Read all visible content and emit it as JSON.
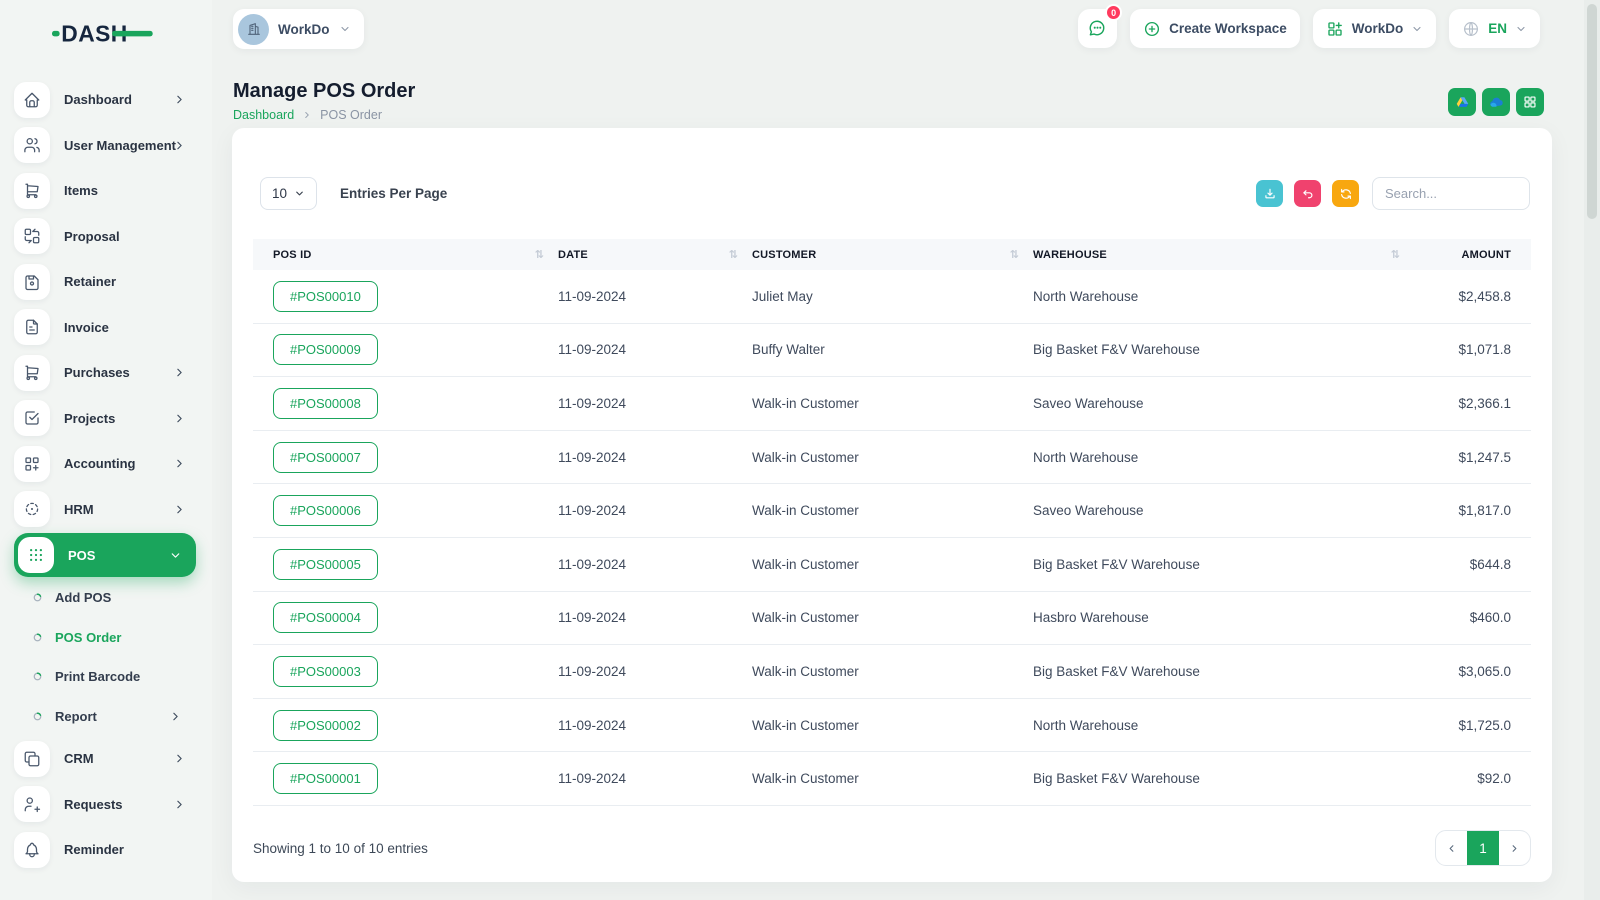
{
  "brand": {
    "logo_text": "DASH"
  },
  "topbar": {
    "workspace_pill_label": "WorkDo",
    "chat_badge": "0",
    "create_workspace_label": "Create Workspace",
    "workspace_menu_label": "WorkDo",
    "language_label": "EN"
  },
  "sidebar": {
    "items_top": [
      {
        "label": "Dashboard"
      },
      {
        "label": "User Management"
      },
      {
        "label": "Items"
      },
      {
        "label": "Proposal"
      },
      {
        "label": "Retainer"
      },
      {
        "label": "Invoice"
      },
      {
        "label": "Purchases"
      },
      {
        "label": "Projects"
      },
      {
        "label": "Accounting"
      },
      {
        "label": "HRM"
      },
      {
        "label": "POS"
      }
    ],
    "pos_submenu": [
      {
        "label": "Add POS"
      },
      {
        "label": "POS Order"
      },
      {
        "label": "Print Barcode"
      },
      {
        "label": "Report"
      }
    ],
    "items_bottom": [
      {
        "label": "CRM"
      },
      {
        "label": "Requests"
      },
      {
        "label": "Reminder"
      }
    ]
  },
  "page": {
    "title": "Manage POS Order",
    "breadcrumb_home": "Dashboard",
    "breadcrumb_current": "POS Order"
  },
  "controls": {
    "entries_value": "10",
    "entries_label": "Entries Per Page",
    "search_placeholder": "Search..."
  },
  "table": {
    "headers": [
      "POS ID",
      "DATE",
      "CUSTOMER",
      "WAREHOUSE",
      "AMOUNT"
    ],
    "rows": [
      {
        "pos_id": "#POS00010",
        "date": "11-09-2024",
        "customer": "Juliet May",
        "warehouse": "North Warehouse",
        "amount": "$2,458.8"
      },
      {
        "pos_id": "#POS00009",
        "date": "11-09-2024",
        "customer": "Buffy Walter",
        "warehouse": "Big Basket F&V Warehouse",
        "amount": "$1,071.8"
      },
      {
        "pos_id": "#POS00008",
        "date": "11-09-2024",
        "customer": "Walk-in Customer",
        "warehouse": "Saveo Warehouse",
        "amount": "$2,366.1"
      },
      {
        "pos_id": "#POS00007",
        "date": "11-09-2024",
        "customer": "Walk-in Customer",
        "warehouse": "North Warehouse",
        "amount": "$1,247.5"
      },
      {
        "pos_id": "#POS00006",
        "date": "11-09-2024",
        "customer": "Walk-in Customer",
        "warehouse": "Saveo Warehouse",
        "amount": "$1,817.0"
      },
      {
        "pos_id": "#POS00005",
        "date": "11-09-2024",
        "customer": "Walk-in Customer",
        "warehouse": "Big Basket F&V Warehouse",
        "amount": "$644.8"
      },
      {
        "pos_id": "#POS00004",
        "date": "11-09-2024",
        "customer": "Walk-in Customer",
        "warehouse": "Hasbro Warehouse",
        "amount": "$460.0"
      },
      {
        "pos_id": "#POS00003",
        "date": "11-09-2024",
        "customer": "Walk-in Customer",
        "warehouse": "Big Basket F&V Warehouse",
        "amount": "$3,065.0"
      },
      {
        "pos_id": "#POS00002",
        "date": "11-09-2024",
        "customer": "Walk-in Customer",
        "warehouse": "North Warehouse",
        "amount": "$1,725.0"
      },
      {
        "pos_id": "#POS00001",
        "date": "11-09-2024",
        "customer": "Walk-in Customer",
        "warehouse": "Big Basket F&V Warehouse",
        "amount": "$92.0"
      }
    ]
  },
  "footer": {
    "summary": "Showing 1 to 10 of 10 entries",
    "current_page": "1"
  },
  "colors": {
    "primary_green": "#1aa55c",
    "teal": "#49c3d2",
    "pink": "#f0426e",
    "orange": "#f8a70f",
    "badge_red": "#ff3a5e"
  }
}
